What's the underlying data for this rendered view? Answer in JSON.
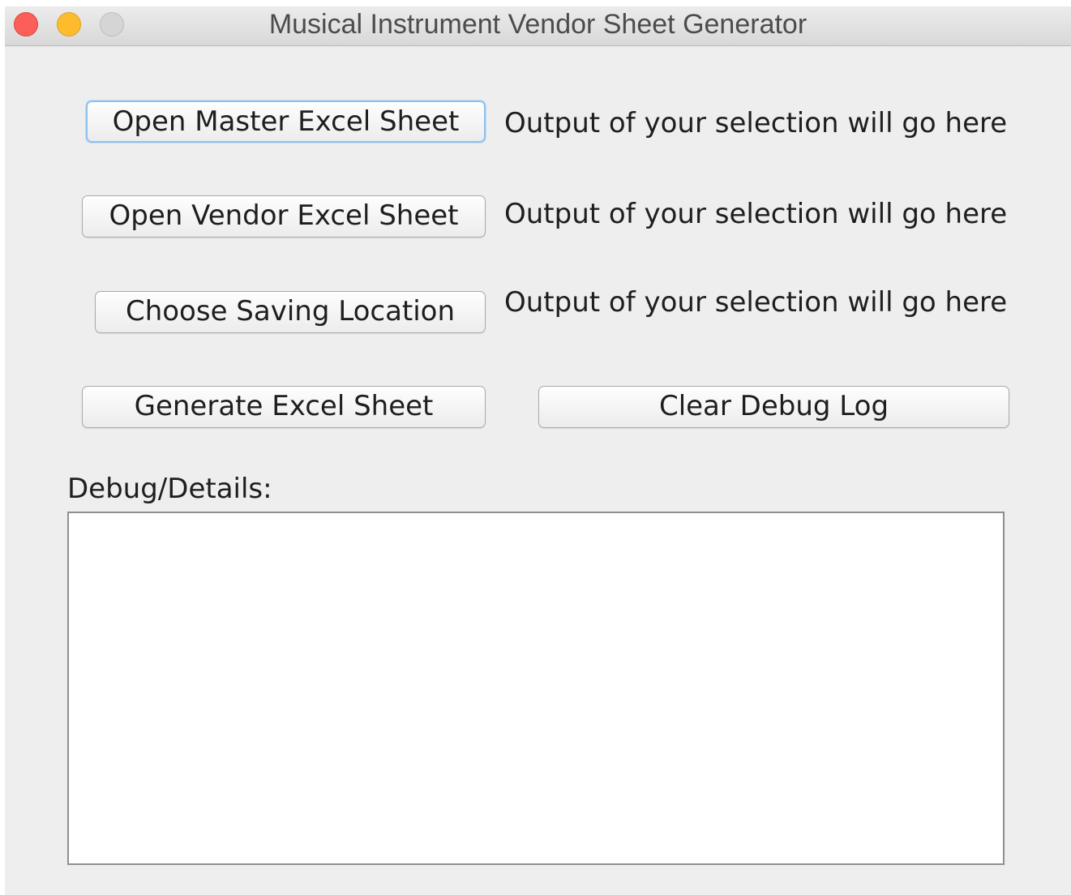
{
  "window": {
    "title": "Musical Instrument Vendor Sheet Generator"
  },
  "buttons": {
    "open_master": "Open Master Excel Sheet",
    "open_vendor": "Open Vendor Excel Sheet",
    "choose_saving": "Choose Saving Location",
    "generate": "Generate Excel Sheet",
    "clear_debug": "Clear Debug Log"
  },
  "outputs": {
    "master": "Output of your selection will go here",
    "vendor": "Output of your selection will go here",
    "saving": "Output of your selection will go here"
  },
  "debug": {
    "label": "Debug/Details:",
    "content": ""
  },
  "colors": {
    "close": "#fc5f57",
    "minimize": "#fdbc2e",
    "zoom_disabled": "#d5d5d5",
    "focus_ring": "#8ec1ef",
    "window_bg": "#eeeeee"
  }
}
